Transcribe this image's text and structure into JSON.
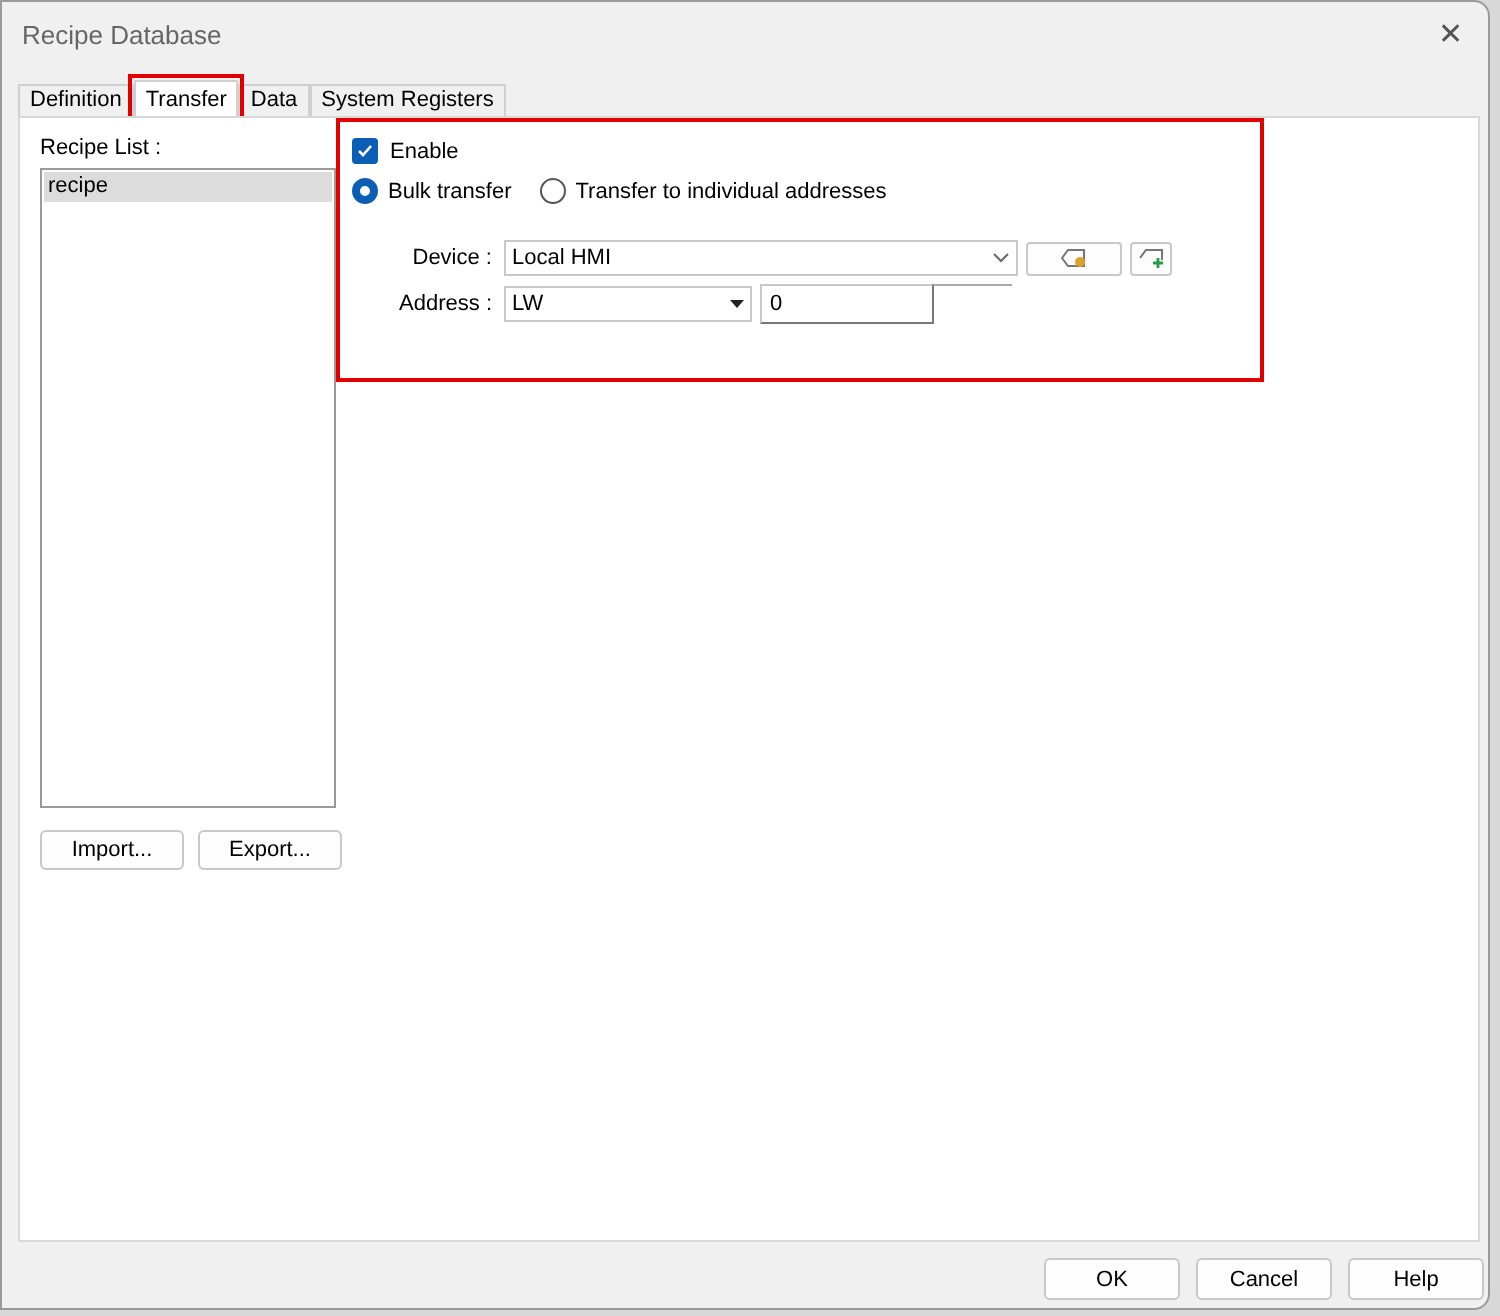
{
  "window": {
    "title": "Recipe Database",
    "close": "✕"
  },
  "tabs": [
    {
      "label": "Definition",
      "selected": false,
      "highlighted": false
    },
    {
      "label": "Transfer",
      "selected": true,
      "highlighted": true
    },
    {
      "label": "Data",
      "selected": false,
      "highlighted": false
    },
    {
      "label": "System Registers",
      "selected": false,
      "highlighted": false
    }
  ],
  "recipe_list": {
    "label": "Recipe List :",
    "items": [
      {
        "label": "recipe",
        "selected": true
      }
    ]
  },
  "list_buttons": [
    "Import...",
    "Export..."
  ],
  "transfer": {
    "highlighted": true,
    "enable": {
      "label": "Enable",
      "checked": true
    },
    "modes": [
      {
        "label": "Bulk transfer",
        "selected": true
      },
      {
        "label": "Transfer to individual addresses",
        "selected": false
      }
    ],
    "device": {
      "label": "Device :",
      "value": "Local HMI"
    },
    "address": {
      "label": "Address :",
      "type": "LW",
      "value": "0"
    }
  },
  "buttons": [
    "OK",
    "Cancel",
    "Help"
  ]
}
